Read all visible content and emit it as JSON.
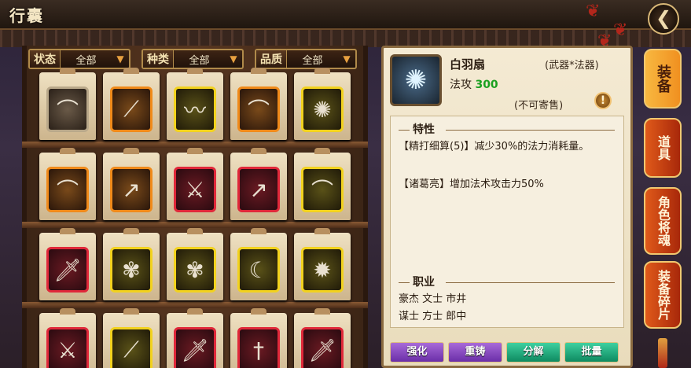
{
  "header": {
    "title": "行囊",
    "back_icon": "back-arrow-icon"
  },
  "filters": [
    {
      "label": "状态",
      "value": "全部"
    },
    {
      "label": "种类",
      "value": "全部"
    },
    {
      "label": "品质",
      "value": "全部"
    }
  ],
  "inventory": [
    {
      "icon": "bow-icon",
      "quality": "grey"
    },
    {
      "icon": "staff-icon",
      "quality": "orange"
    },
    {
      "icon": "whip-icon",
      "quality": "yellow"
    },
    {
      "icon": "bow-icon",
      "quality": "orange"
    },
    {
      "icon": "fan-icon",
      "quality": "yellow"
    },
    {
      "icon": "bow-icon",
      "quality": "orange"
    },
    {
      "icon": "spear-icon",
      "quality": "orange"
    },
    {
      "icon": "halberd-icon",
      "quality": "red"
    },
    {
      "icon": "spear-icon",
      "quality": "red"
    },
    {
      "icon": "bow-icon",
      "quality": "yellow"
    },
    {
      "icon": "sword-icon",
      "quality": "red"
    },
    {
      "icon": "feather-fan-icon",
      "quality": "yellow"
    },
    {
      "icon": "feather-fan-icon",
      "quality": "yellow"
    },
    {
      "icon": "scimitar-icon",
      "quality": "yellow"
    },
    {
      "icon": "mace-icon",
      "quality": "yellow"
    },
    {
      "icon": "blade-icon",
      "quality": "red"
    },
    {
      "icon": "sabre-icon",
      "quality": "yellow"
    },
    {
      "icon": "sword-icon",
      "quality": "red"
    },
    {
      "icon": "dagger-icon",
      "quality": "red"
    },
    {
      "icon": "sword-icon",
      "quality": "red"
    }
  ],
  "detail": {
    "name": "白羽扇",
    "type": "(武器*法器)",
    "stat_label": "法攻",
    "stat_value": "300",
    "flag": "(不可寄售)",
    "traits_title": "特性",
    "traits": [
      "【精打细算(5)】减少30%的法力消耗量。",
      "【诸葛亮】增加法术攻击力50%"
    ],
    "jobs_title": "职业",
    "jobs": [
      "豪杰 文士 市井",
      "谋士 方士 郎中"
    ]
  },
  "actions": [
    {
      "label": "强化"
    },
    {
      "label": "重铸"
    },
    {
      "label": "分解"
    },
    {
      "label": "批量"
    }
  ],
  "tabs": [
    {
      "label": "装备"
    },
    {
      "label": "道具"
    },
    {
      "label": "角色将魂"
    },
    {
      "label": "装备碎片"
    }
  ],
  "colors": {
    "stat_value": "#1aa020",
    "active_tab": "#f8b840",
    "inactive_tab": "#e05a1a"
  }
}
